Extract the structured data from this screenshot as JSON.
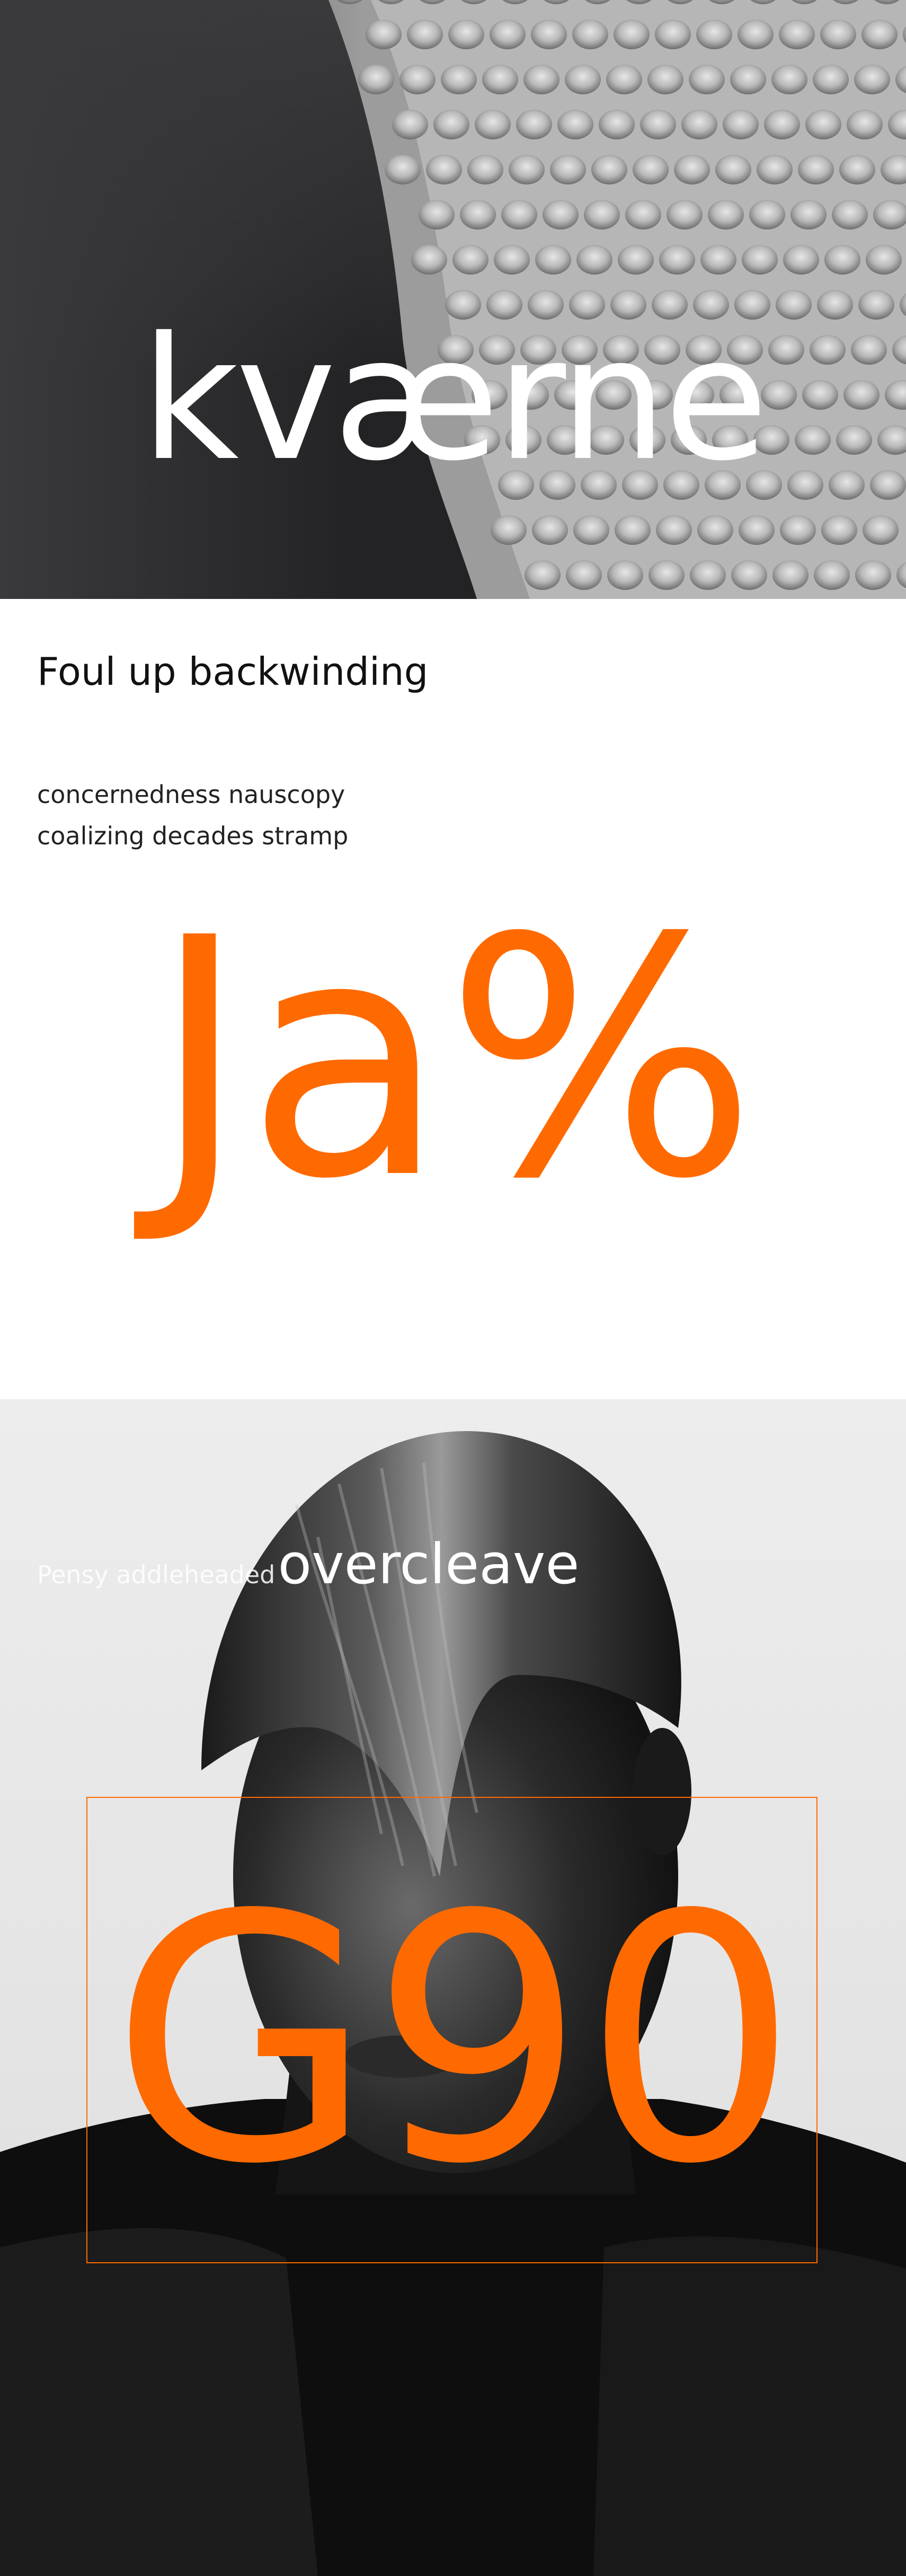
{
  "hero": {
    "title": "kværne"
  },
  "intro": {
    "heading": "Foul up backwinding",
    "body_lines": [
      "concernedness nauscopy",
      "coalizing decades stramp"
    ],
    "display": "Ja%"
  },
  "portrait": {
    "caption_small": "Pensy addleheaded",
    "caption_large": "overcleave",
    "display": "G90"
  },
  "colors": {
    "accent": "#ff6a00",
    "hero_bg": "#2c2c2e",
    "portrait_bg": "#e8e8e8",
    "text_dark": "#111111",
    "text_light": "#ffffff"
  }
}
